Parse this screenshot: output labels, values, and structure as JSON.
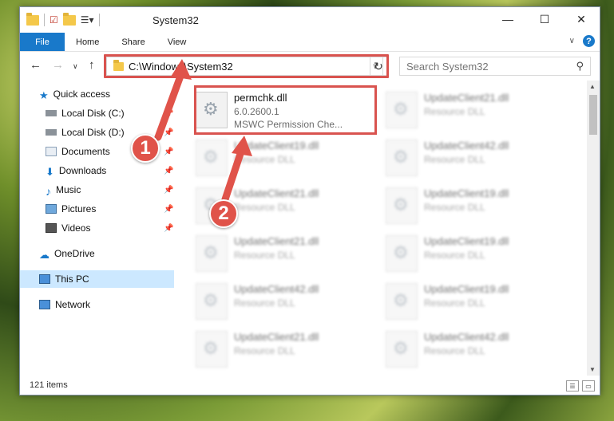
{
  "window": {
    "title": "System32",
    "controls": {
      "minimize": "—",
      "maximize": "☐",
      "close": "✕"
    }
  },
  "ribbon": {
    "tabs": [
      "File",
      "Home",
      "Share",
      "View"
    ],
    "expand": "∨",
    "help": "?"
  },
  "address": {
    "path": "C:\\Windows\\System32",
    "dropdown": "∨",
    "refresh": "↻"
  },
  "search": {
    "placeholder": "Search System32",
    "icon": "⚲"
  },
  "nav": {
    "back": "←",
    "forward": "→",
    "recent": "∨",
    "up": "↑",
    "items": [
      {
        "label": "Quick access",
        "icon": "star-icon",
        "pinned": false
      },
      {
        "label": "Local Disk (C:)",
        "icon": "drive-icon",
        "pinned": true
      },
      {
        "label": "Local Disk (D:)",
        "icon": "drive-icon",
        "pinned": true
      },
      {
        "label": "Documents",
        "icon": "documents-icon",
        "pinned": true
      },
      {
        "label": "Downloads",
        "icon": "download-icon",
        "pinned": true
      },
      {
        "label": "Music",
        "icon": "music-icon",
        "pinned": true
      },
      {
        "label": "Pictures",
        "icon": "pictures-icon",
        "pinned": true
      },
      {
        "label": "Videos",
        "icon": "videos-icon",
        "pinned": true
      },
      {
        "label": "OneDrive",
        "icon": "cloud-icon",
        "pinned": false
      },
      {
        "label": "This PC",
        "icon": "computer-icon",
        "pinned": false
      },
      {
        "label": "Network",
        "icon": "network-icon",
        "pinned": false
      }
    ]
  },
  "files": {
    "selected": {
      "name": "permchk.dll",
      "version": "6.0.2600.1",
      "description": "MSWC Permission Che..."
    },
    "others": [
      {
        "name": "UpdateClient21.dll",
        "type": "Resource DLL"
      },
      {
        "name": "UpdateClient19.dll",
        "type": "Resource DLL"
      },
      {
        "name": "UpdateClient42.dll",
        "type": "Resource DLL"
      },
      {
        "name": "UpdateClient21.dll",
        "type": "Resource DLL"
      },
      {
        "name": "UpdateClient19.dll",
        "type": "Resource DLL"
      },
      {
        "name": "UpdateClient21.dll",
        "type": "Resource DLL"
      },
      {
        "name": "UpdateClient19.dll",
        "type": "Resource DLL"
      },
      {
        "name": "UpdateClient42.dll",
        "type": "Resource DLL"
      },
      {
        "name": "UpdateClient19.dll",
        "type": "Resource DLL"
      },
      {
        "name": "UpdateClient21.dll",
        "type": "Resource DLL"
      },
      {
        "name": "UpdateClient42.dll",
        "type": "Resource DLL"
      }
    ]
  },
  "status": {
    "count": "121 items"
  },
  "annotations": {
    "badge1": "1",
    "badge2": "2",
    "color": "#e0534a"
  }
}
